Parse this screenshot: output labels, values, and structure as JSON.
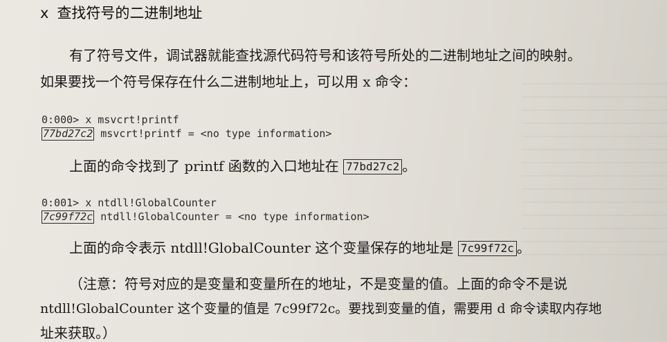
{
  "section": {
    "cmd": "x",
    "title": "查找符号的二进制地址"
  },
  "intro": {
    "line1": "有了符号文件，调试器就能查找源代码符号和该符号所处的二进制地址之间的映射。",
    "line2": "如果要找一个符号保存在什么二进制地址上，可以用 x 命令："
  },
  "example1": {
    "command": "0:000> x msvcrt!printf",
    "address": "77bd27c2",
    "result": " msvcrt!printf = <no type information>"
  },
  "note1": {
    "before": "上面的命令找到了 printf 函数的入口地址在 ",
    "address": "77bd27c2",
    "after": "。"
  },
  "example2": {
    "command": "0:001> x ntdll!GlobalCounter",
    "address": "7c99f72c",
    "result": " ntdll!GlobalCounter = <no type information>"
  },
  "note2": {
    "before": "上面的命令表示 ntdll!GlobalCounter 这个变量保存的地址是 ",
    "address": "7c99f72c",
    "after": "。"
  },
  "caution": {
    "line1": "（注意：符号对应的是变量和变量所在的地址，不是变量的值。上面的命令不是说",
    "line2": "ntdll!GlobalCounter 这个变量的值是 7c99f72c。要找到变量的值，需要用 d 命令读取内存地",
    "line3": "址来获取。）"
  }
}
